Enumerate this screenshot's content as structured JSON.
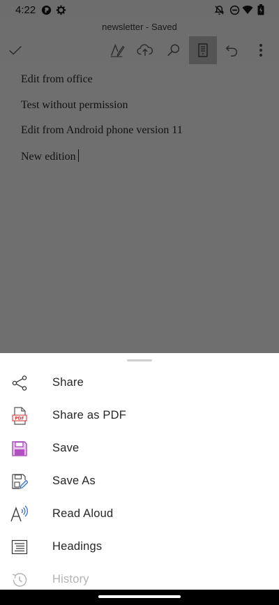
{
  "status_bar": {
    "time": "4:22",
    "left_icons": [
      "app-notification-icon",
      "settings-icon"
    ],
    "right_icons": [
      "notifications-off-icon",
      "do-not-disturb-icon",
      "wifi-icon",
      "battery-icon"
    ]
  },
  "document": {
    "title": "newsletter - Saved",
    "lines": [
      "Edit from office",
      "Test without permission",
      "Edit from Android phone version 11",
      "New edition"
    ]
  },
  "toolbar": {
    "buttons": [
      "checkmark-icon",
      "draw-icon",
      "cloud-upload-icon",
      "search-icon",
      "page-layout-icon",
      "undo-icon",
      "more-options-icon"
    ],
    "active": "page-layout-icon"
  },
  "sheet": {
    "items": [
      {
        "label": "Share",
        "icon": "share-icon"
      },
      {
        "label": "Share as PDF",
        "icon": "pdf-file-icon"
      },
      {
        "label": "Save",
        "icon": "save-icon"
      },
      {
        "label": "Save As",
        "icon": "save-as-icon"
      },
      {
        "label": "Read Aloud",
        "icon": "read-aloud-icon"
      },
      {
        "label": "Headings",
        "icon": "headings-icon"
      },
      {
        "label": "History",
        "icon": "history-icon"
      }
    ]
  },
  "colors": {
    "scrim_background": "#6e6e6e",
    "sheet_background": "#ffffff",
    "save_icon_accent": "#b24fc3",
    "pdf_icon_accent": "#d63b3b"
  }
}
